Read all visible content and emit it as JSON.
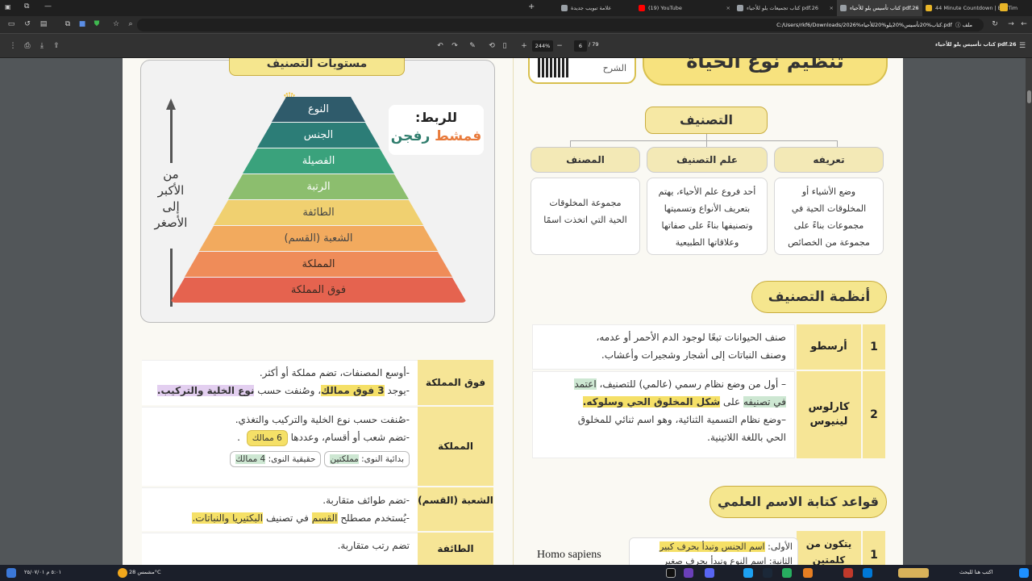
{
  "tabs": [
    {
      "label": "44 Minute Countdown | Big Tim",
      "active": false,
      "color": "#e8b528"
    },
    {
      "label": "كتاب تأسيس يلو للأحياء pdf.26",
      "active": true,
      "color": "#9aa0a6"
    },
    {
      "label": "كتاب تجميعات يلو للأحياء pdf.26",
      "active": false,
      "color": "#9aa0a6"
    },
    {
      "label": "(19) YouTube",
      "active": false,
      "color": "#ff0000"
    },
    {
      "label": "علامة تبويب جديدة",
      "active": false,
      "color": "#9aa0a6"
    }
  ],
  "address": {
    "url": "C:/Users/rkf6/Downloads/2026%كتاب%20تأسيس%20يلو%20للأحياء.pdf",
    "prefix": "ملف"
  },
  "pdf_toolbar": {
    "title": "كتاب تأسيس يلو للأحياء pdf.26",
    "page_current": "6",
    "page_total": "/ 79",
    "zoom": "244%"
  },
  "right_col": {
    "title_top": "تنظيم نوع الحياة",
    "qr_caption": "الشرح",
    "classification": {
      "root": "التصنيف",
      "heads": [
        "تعريفه",
        "علم التصنيف",
        "المصنف"
      ],
      "bodies": [
        "وضع الأشياء أو\nالمخلوقات الحية في\nمجموعات بناءً على\nمجموعة من الخصائص",
        "أحد فروع علم الأحياء، يهتم\nبتعريف الأنواع وتسميتها\nوتصنيفها بناءً على صفاتها\nوعلاقاتها الطبيعية",
        "مجموعة المخلوقات\nالحية التي اتخذت اسمًا"
      ]
    },
    "systems_title": "أنظمة التصنيف",
    "systems": [
      {
        "num": "1",
        "name": "أرسطو",
        "body1": "صنف الحيوانات تبعًا لوجود الدم الأحمر أو عدمه،",
        "body2": "وصنف النباتات إلى أشجار وشجيرات وأعشاب."
      },
      {
        "num": "2",
        "name": "كارلوس لينيوس",
        "b1a": "– أول من وضع نظام رسمي (عالمي) للتصنيف، ",
        "b1b": "اعتمد",
        "b2a": "في تصنيفه",
        "b2b": " على ",
        "b2c": "شكل المخلوق الحي وسلوكه.",
        "b3": "–وضع نظام التسمية الثنائية، وهو اسم ثنائي للمخلوق",
        "b4": "الحي باللغة اللاتينية."
      }
    ],
    "rules_title": "قواعد كتابة الاسم العلمي",
    "rules": {
      "num": "1",
      "name": "يتكون من كلمتين",
      "hint1a": "الأولى: ",
      "hint1b": "اسم الجنس وتبدأ بحرف كبير",
      "hint2": "الثانية: اسم النوع وتبدأ بحرف صغير",
      "example": "Homo sapiens"
    }
  },
  "left_col": {
    "levels_title": "مستويات التصنيف",
    "mnemonic_label": "للربط:",
    "mnemonic_words": [
      "فمشط",
      "رفجن"
    ],
    "arrow_text": [
      "من",
      "الأكبر",
      "إلى",
      "الأصغر"
    ],
    "pyramid": [
      "النوع",
      "الجنس",
      "الفصيلة",
      "الرتبة",
      "الطائفة",
      "الشعبة (القسم)",
      "المملكة",
      "فوق المملكة"
    ],
    "pyramid_colors": [
      "#2f5b6b",
      "#2c7d77",
      "#3aa27c",
      "#8cbe6e",
      "#f0d070",
      "#f2aa5e",
      "#ef8c59",
      "#e5634f"
    ],
    "table": [
      {
        "key": "فوق المملكة",
        "lines": [
          "-أوسع المصنفات، تضم مملكة أو أكثر."
        ],
        "l2a": "-يوجد ",
        "l2b": "3 فوق ممالك",
        "l2c": "، وصُنفت حسب ",
        "l2d": "نوع الخلية والتركيب."
      },
      {
        "key": "المملكة",
        "l1": "-صُنفت حسب نوع الخلية والتركيب والتغذي.",
        "l2": "-تضم شعب أو أقسام، وعددها",
        "l2b": "6 ممالك",
        "chip1a": "بدائية النوى: ",
        "chip1b": "مملكتين",
        "chip2a": "حقيقية النوى: ",
        "chip2b": "4 ممالك"
      },
      {
        "key": "الشعبة (القسم)",
        "l1": "-تضم طوائف متقاربة.",
        "l2a": "-يُستخدم مصطلح ",
        "l2b": "القسم",
        "l2c": " في تصنيف ",
        "l2d": "البكتيريا والنباتات."
      },
      {
        "key": "الطائفة",
        "l1": "تضم رتب متقاربة."
      }
    ]
  },
  "taskbar": {
    "weather": "مشمس 28°C",
    "search": "اكتب هنا للبحث",
    "time": "٥:٠١ م",
    "date": "٢٥/٠٧/٠١"
  }
}
